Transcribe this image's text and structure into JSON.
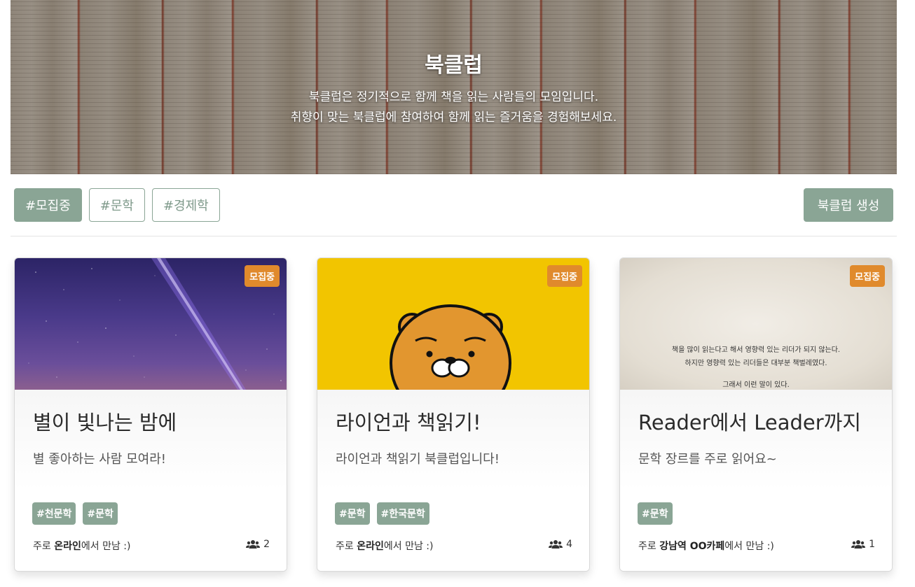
{
  "hero": {
    "title": "북클럽",
    "desc_line1": "북클럽은 정기적으로 함께 책을 읽는 사람들의 모임입니다.",
    "desc_line2": "취향이 맞는 북클럽에 참여하여 함께 읽는 즐거움을 경험해보세요."
  },
  "filters": [
    {
      "label": "#모집중",
      "active": true
    },
    {
      "label": "#문학",
      "active": false
    },
    {
      "label": "#경제학",
      "active": false
    }
  ],
  "create_button": "북클럽 생성",
  "colors": {
    "accent": "#8aa595",
    "badge": "#e08a2c"
  },
  "cards": [
    {
      "badge": "모집중",
      "title": "별이 빛나는 밤에",
      "desc": "별 좋아하는 사람 모여라!",
      "tags": [
        "#천문학",
        "#문학"
      ],
      "meet_prefix": "주로 ",
      "meet_place": "온라인",
      "meet_suffix": "에서 만남 :)",
      "members": "2",
      "image_icon": "night-sky-image"
    },
    {
      "badge": "모집중",
      "title": "라이언과 책읽기!",
      "desc": "라이언과 책읽기 북클럽입니다!",
      "tags": [
        "#문학",
        "#한국문학"
      ],
      "meet_prefix": "주로 ",
      "meet_place": "온라인",
      "meet_suffix": "에서 만남 :)",
      "members": "4",
      "image_icon": "ryan-character-image"
    },
    {
      "badge": "모집중",
      "title": "Reader에서 Leader까지",
      "desc": "문학 장르를 주로 읽어요~",
      "tags": [
        "#문학"
      ],
      "meet_prefix": "주로 ",
      "meet_place": "강남역 OO카페",
      "meet_suffix": "에서 만남 :)",
      "members": "1",
      "image_icon": "quote-paper-image",
      "image_text": [
        "책을 많이 읽는다고 해서 영향력 있는 리더가 되지 않는다.",
        "하지만 영향력 있는 리더들은 대부분 책벌레였다.",
        "그래서 이런 말이 있다."
      ]
    }
  ]
}
